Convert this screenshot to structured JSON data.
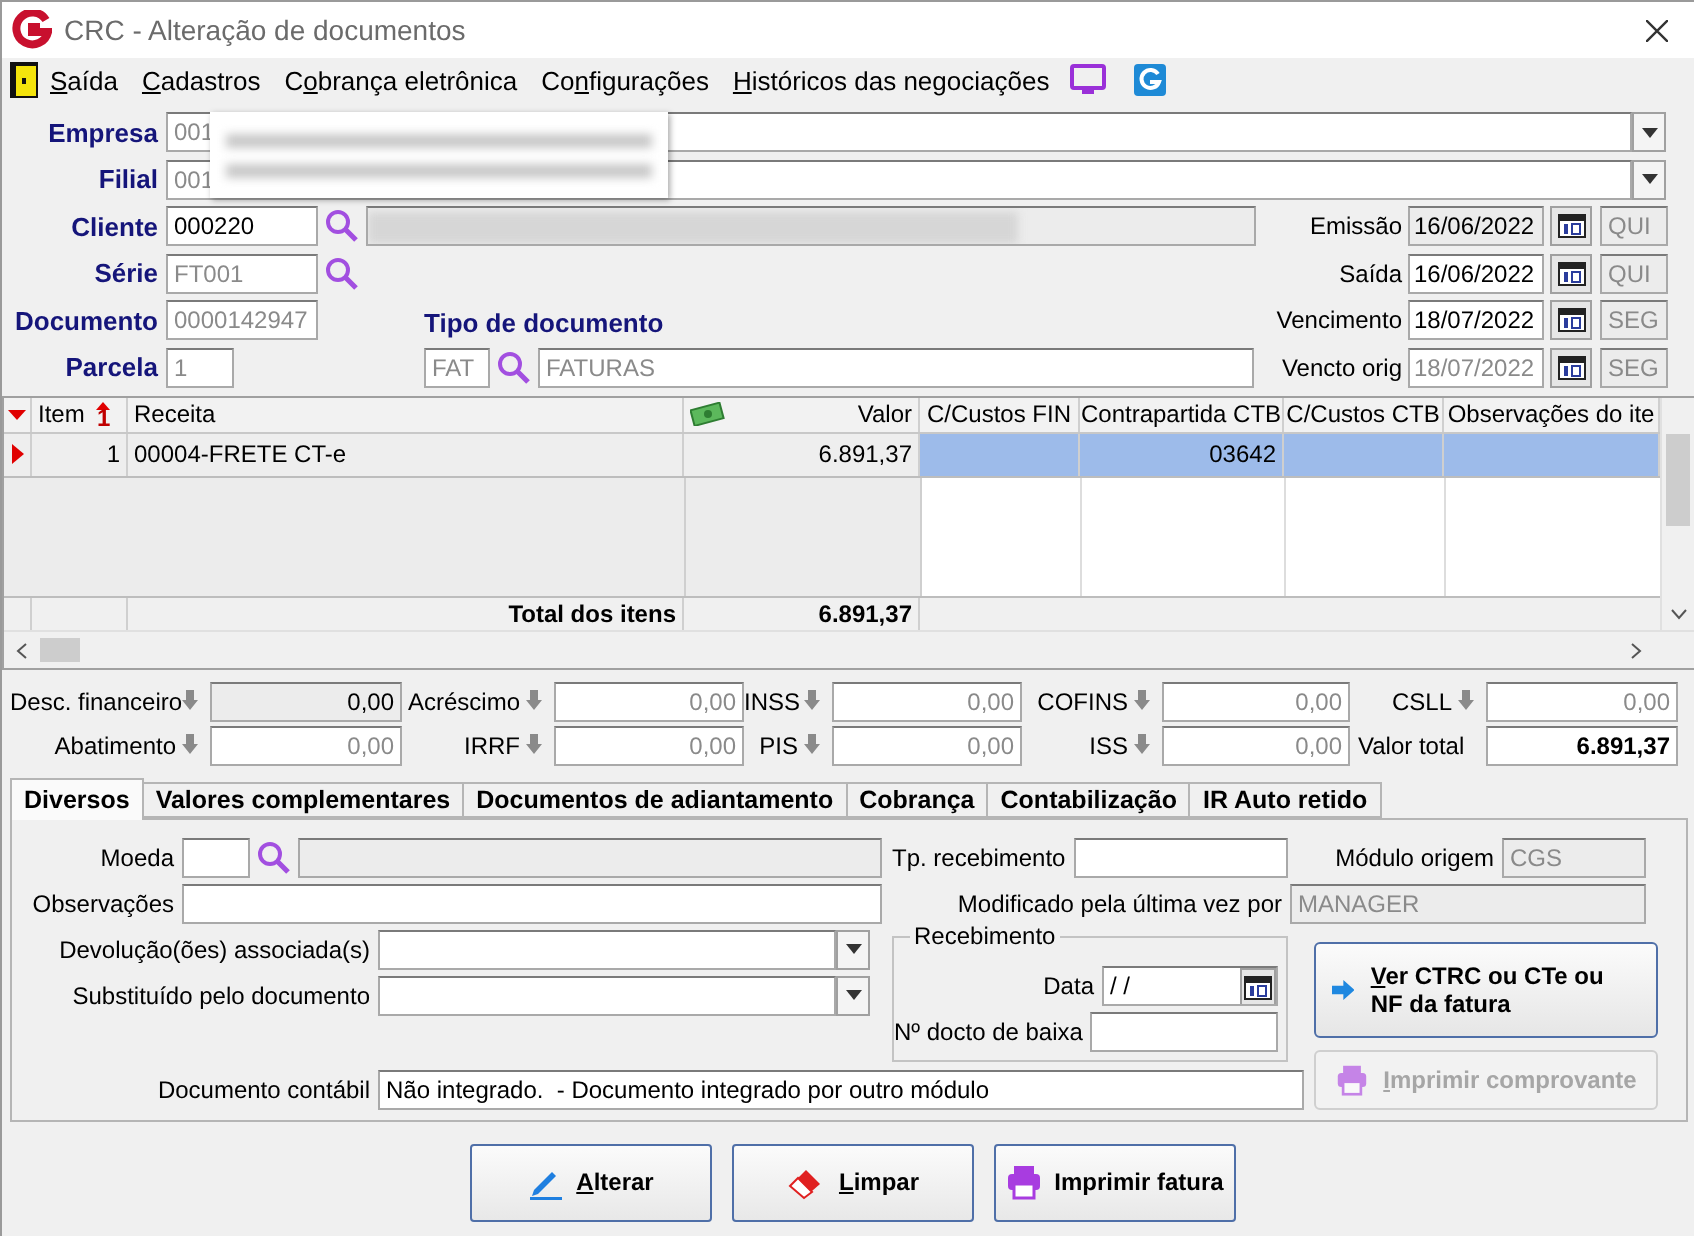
{
  "window": {
    "title": "CRC - Alteração de documentos"
  },
  "menu": [
    {
      "accel": "S",
      "rest": "aída"
    },
    {
      "accel": "C",
      "rest": "adastros"
    },
    {
      "prefix": "C",
      "accel": "o",
      "rest": "brança eletrônica"
    },
    {
      "prefix": "Co",
      "accel": "n",
      "rest": "figurações"
    },
    {
      "accel": "H",
      "rest": "istóricos das negociações"
    }
  ],
  "header": {
    "empresa": {
      "label": "Empresa",
      "code": "001",
      "disabled": true
    },
    "filial": {
      "label": "Filial",
      "code": "001",
      "disabled": true
    },
    "cliente": {
      "label": "Cliente",
      "code": "000220",
      "disabled": false
    },
    "serie": {
      "label": "Série",
      "value": "FT001",
      "disabled": true
    },
    "documento": {
      "label": "Documento",
      "value": "0000142947",
      "disabled": true
    },
    "parcela": {
      "label": "Parcela",
      "value": "1",
      "disabled": true
    },
    "tipo_documento": {
      "label": "Tipo de documento",
      "code": "FAT",
      "description": "FATURAS",
      "disabled": true
    }
  },
  "dates": [
    {
      "label": "Emissão",
      "date": "16/06/2022",
      "weekday": "QUI",
      "readonly": true,
      "disabled": false
    },
    {
      "label": "Saída",
      "date": "16/06/2022",
      "weekday": "QUI",
      "readonly": false,
      "disabled": false
    },
    {
      "label": "Vencimento",
      "date": "18/07/2022",
      "weekday": "SEG",
      "readonly": false,
      "disabled": false
    },
    {
      "label": "Vencto orig",
      "date": "18/07/2022",
      "weekday": "SEG",
      "readonly": false,
      "disabled": true
    }
  ],
  "grid": {
    "columns": [
      {
        "label": "Item",
        "kind": "index",
        "sort_order": "1"
      },
      {
        "label": "Receita",
        "kind": "text"
      },
      {
        "label": "Valor",
        "kind": "amount"
      },
      {
        "label": "C/Custos FIN",
        "kind": "code"
      },
      {
        "label": "Contrapartida CTB",
        "kind": "code"
      },
      {
        "label": "C/Custos CTB",
        "kind": "code"
      },
      {
        "label": "Observações do ite",
        "kind": "code"
      }
    ],
    "rows": [
      {
        "selected": true,
        "cells": [
          "1",
          "00004-FRETE CT-e",
          "6.891,37",
          null,
          "03642",
          null,
          null
        ]
      }
    ],
    "total": {
      "label": "Total dos itens",
      "value": "6.891,37"
    }
  },
  "totals": [
    {
      "label": "Desc. financeiro",
      "value": "0,00",
      "kind": "amount",
      "readonly": true
    },
    {
      "label": "Acréscimo",
      "value": "0,00",
      "kind": "amount",
      "readonly": false
    },
    {
      "label": "INSS",
      "value": "0,00",
      "kind": "amount",
      "readonly": false
    },
    {
      "label": "COFINS",
      "value": "0,00",
      "kind": "amount",
      "readonly": false
    },
    {
      "label": "CSLL",
      "value": "0,00",
      "kind": "amount",
      "readonly": false
    },
    {
      "label": "Abatimento",
      "value": "0,00",
      "kind": "amount",
      "readonly": false
    },
    {
      "label": "IRRF",
      "value": "0,00",
      "kind": "amount",
      "readonly": false
    },
    {
      "label": "PIS",
      "value": "0,00",
      "kind": "amount",
      "readonly": false
    },
    {
      "label": "ISS",
      "value": "0,00",
      "kind": "amount",
      "readonly": false
    },
    {
      "label": "Valor total",
      "value": "6.891,37",
      "kind": "total",
      "readonly": false
    }
  ],
  "tabs": [
    {
      "label": "Diversos",
      "selected": true
    },
    {
      "label": "Valores complementares",
      "selected": false
    },
    {
      "label": "Documentos de adiantamento",
      "selected": false
    },
    {
      "label": "Cobrança",
      "selected": false
    },
    {
      "label": "Contabilização",
      "selected": false
    },
    {
      "label": "IR Auto retido",
      "selected": false
    }
  ],
  "diversos": {
    "moeda": {
      "label": "Moeda"
    },
    "observacoes": {
      "label": "Observações"
    },
    "devolucoes": {
      "label": "Devolução(ões) associada(s)"
    },
    "substituido": {
      "label": "Substituído pelo documento"
    },
    "tp_recebimento": {
      "label": "Tp. recebimento"
    },
    "modulo_origem": {
      "label": "Módulo origem",
      "value": "CGS"
    },
    "modificado_por": {
      "label": "Modificado pela última vez por",
      "value": "MANAGER"
    },
    "recebimento": {
      "title": "Recebimento",
      "data": {
        "label": "Data",
        "value": "/ /"
      },
      "docto_baixa": {
        "label": "Nº docto de baixa"
      }
    },
    "documento_contabil": {
      "label": "Documento contábil",
      "value": "Não integrado.  - Documento integrado por outro módulo"
    },
    "actions": [
      {
        "accel": "V",
        "rest": "er CTRC ou CTe ou NF da fatura",
        "kind": "view",
        "disabled": false
      },
      {
        "accel": "I",
        "rest": "mprimir comprovante",
        "kind": "print",
        "disabled": true
      }
    ]
  },
  "buttons": [
    {
      "accel": "A",
      "rest": "lterar",
      "kind": "edit"
    },
    {
      "accel": "L",
      "rest": "impar",
      "kind": "clear"
    },
    {
      "label": "Imprimir fatura",
      "kind": "print"
    }
  ]
}
